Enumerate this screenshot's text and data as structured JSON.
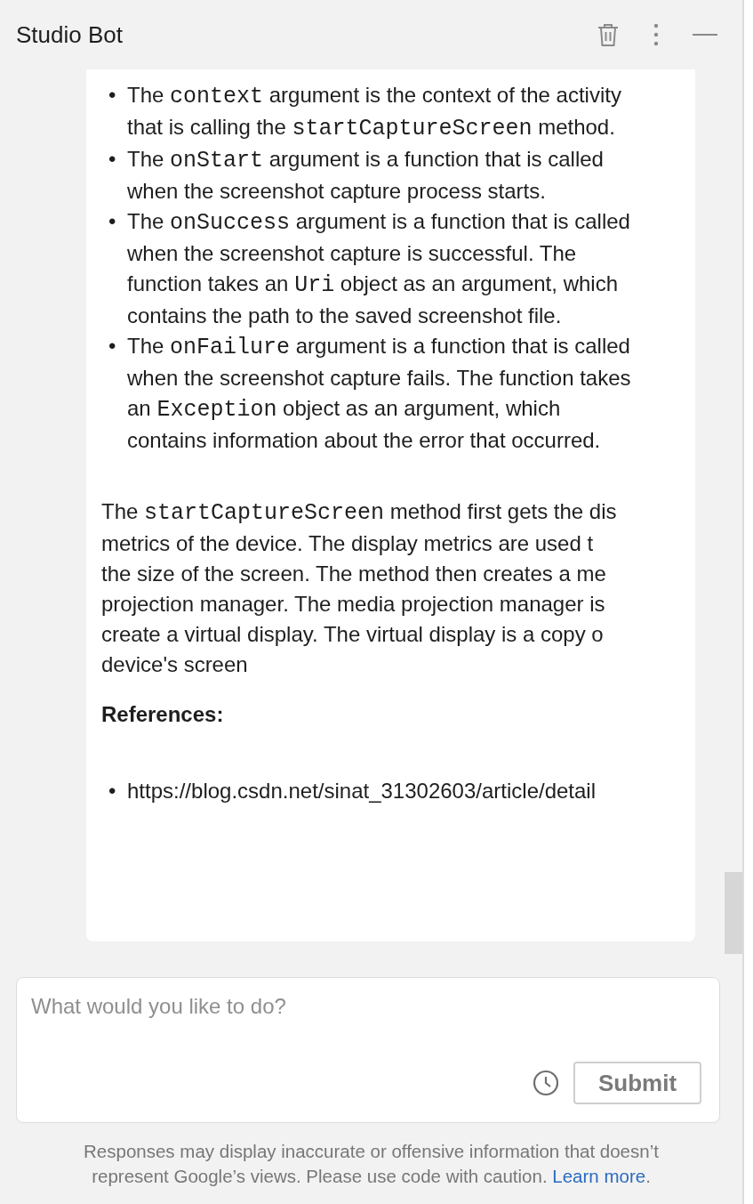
{
  "header": {
    "title": "Studio Bot"
  },
  "bullets": [
    {
      "segments": [
        {
          "kind": "text",
          "text": "The "
        },
        {
          "kind": "code",
          "text": "context"
        },
        {
          "kind": "text",
          "text": " argument is the context of the activity that is calling the "
        },
        {
          "kind": "code",
          "text": "startCaptureScreen"
        },
        {
          "kind": "text",
          "text": " method."
        }
      ]
    },
    {
      "segments": [
        {
          "kind": "text",
          "text": "The "
        },
        {
          "kind": "code",
          "text": "onStart"
        },
        {
          "kind": "text",
          "text": " argument is a function that is called when the screenshot capture process starts."
        }
      ]
    },
    {
      "segments": [
        {
          "kind": "text",
          "text": "The "
        },
        {
          "kind": "code",
          "text": "onSuccess"
        },
        {
          "kind": "text",
          "text": " argument is a function that is called when the screenshot capture is successful. The function takes an "
        },
        {
          "kind": "code",
          "text": "Uri"
        },
        {
          "kind": "text",
          "text": " object as an argument, which contains the path to the saved screenshot file."
        }
      ]
    },
    {
      "segments": [
        {
          "kind": "text",
          "text": "The "
        },
        {
          "kind": "code",
          "text": "onFailure"
        },
        {
          "kind": "text",
          "text": " argument is a function that is called when the screenshot capture fails. The function takes an "
        },
        {
          "kind": "code",
          "text": "Exception"
        },
        {
          "kind": "text",
          "text": " object as an argument, which contains information about the error that occurred."
        }
      ]
    }
  ],
  "paragraph_lines": [
    [
      {
        "kind": "text",
        "text": "The "
      },
      {
        "kind": "code",
        "text": "startCaptureScreen"
      },
      {
        "kind": "text",
        "text": " method first gets the dis"
      }
    ],
    [
      {
        "kind": "text",
        "text": "metrics of the device. The display metrics are used t"
      }
    ],
    [
      {
        "kind": "text",
        "text": "the size of the screen. The method then creates a me"
      }
    ],
    [
      {
        "kind": "text",
        "text": "projection manager. The media projection manager is"
      }
    ],
    [
      {
        "kind": "text",
        "text": "create a virtual display. The virtual display is a copy o"
      }
    ],
    [
      {
        "kind": "text",
        "text": "device's screen"
      }
    ]
  ],
  "bullet_marker": "•",
  "references": {
    "heading": "References:",
    "items": [
      "https://blog.csdn.net/sinat_31302603/article/detail"
    ]
  },
  "input": {
    "placeholder": "What would you like to do?",
    "submit": "Submit"
  },
  "disclaimer": {
    "text": "Responses may display inaccurate or offensive information that doesn’t represent Google’s views. Please use code with caution.",
    "link": "Learn more",
    "end": "."
  }
}
